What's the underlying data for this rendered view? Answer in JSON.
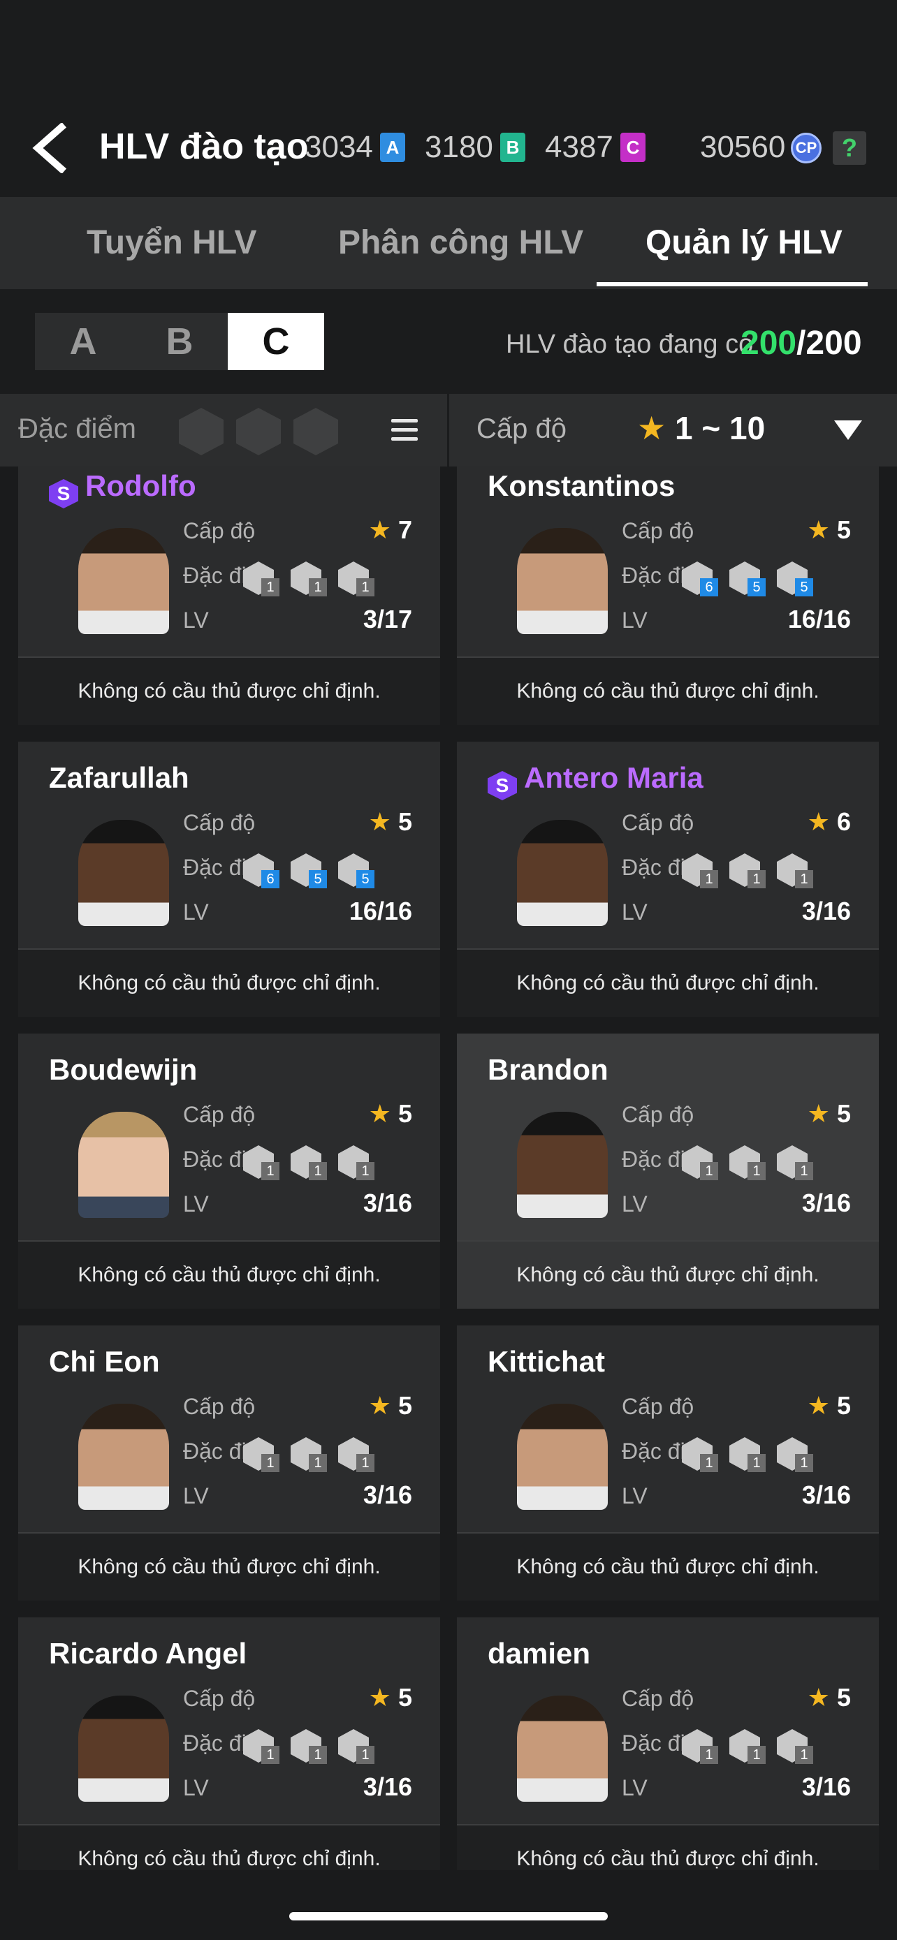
{
  "header": {
    "title": "HLV đào tạo",
    "currencies": [
      {
        "value": "3034",
        "chip": "A"
      },
      {
        "value": "3180",
        "chip": "B"
      },
      {
        "value": "4387",
        "chip": "C"
      }
    ],
    "cp_value": "30560",
    "cp_label": "CP",
    "help_label": "?"
  },
  "tabs": [
    {
      "label": "Tuyển HLV"
    },
    {
      "label": "Phân công HLV"
    },
    {
      "label": "Quản lý HLV"
    }
  ],
  "active_tab": "Quản lý HLV",
  "grades": [
    "A",
    "B",
    "C"
  ],
  "active_grade": "C",
  "coach_count": {
    "label": "HLV đào tạo đang có",
    "current": "200",
    "max": "/200"
  },
  "filter": {
    "traits_label": "Đặc điểm đ",
    "level_label": "Cấp độ",
    "range_star": "★",
    "range_text": "1 ~ 10"
  },
  "labels": {
    "level": "Cấp độ",
    "trait": "Đặc điểm",
    "lv": "LV",
    "no_player": "Không có cầu thủ được chỉ định.",
    "star": "★",
    "s_badge": "S"
  },
  "coaches": [
    {
      "name": "Rodolfo",
      "special": true,
      "level": "7",
      "lv": "3/17",
      "traits": [
        "1",
        "1",
        "1"
      ],
      "blue": false
    },
    {
      "name": "Konstantinos",
      "special": false,
      "level": "5",
      "lv": "16/16",
      "traits": [
        "6",
        "5",
        "5"
      ],
      "blue": true
    },
    {
      "name": "Zafarullah",
      "special": false,
      "level": "5",
      "lv": "16/16",
      "traits": [
        "6",
        "5",
        "5"
      ],
      "blue": true
    },
    {
      "name": "Antero Maria",
      "special": true,
      "level": "6",
      "lv": "3/16",
      "traits": [
        "1",
        "1",
        "1"
      ],
      "blue": false
    },
    {
      "name": "Boudewijn",
      "special": false,
      "level": "5",
      "lv": "3/16",
      "traits": [
        "1",
        "1",
        "1"
      ],
      "blue": false
    },
    {
      "name": "Brandon",
      "special": false,
      "level": "5",
      "lv": "3/16",
      "traits": [
        "1",
        "1",
        "1"
      ],
      "blue": false
    },
    {
      "name": "Chi Eon",
      "special": false,
      "level": "5",
      "lv": "3/16",
      "traits": [
        "1",
        "1",
        "1"
      ],
      "blue": false
    },
    {
      "name": "Kittichat",
      "special": false,
      "level": "5",
      "lv": "3/16",
      "traits": [
        "1",
        "1",
        "1"
      ],
      "blue": false
    },
    {
      "name": "Ricardo Angel",
      "special": false,
      "level": "5",
      "lv": "3/16",
      "traits": [
        "1",
        "1",
        "1"
      ],
      "blue": false
    },
    {
      "name": "damien",
      "special": false,
      "level": "5",
      "lv": "3/16",
      "traits": [
        "1",
        "1",
        "1"
      ],
      "blue": false
    }
  ]
}
